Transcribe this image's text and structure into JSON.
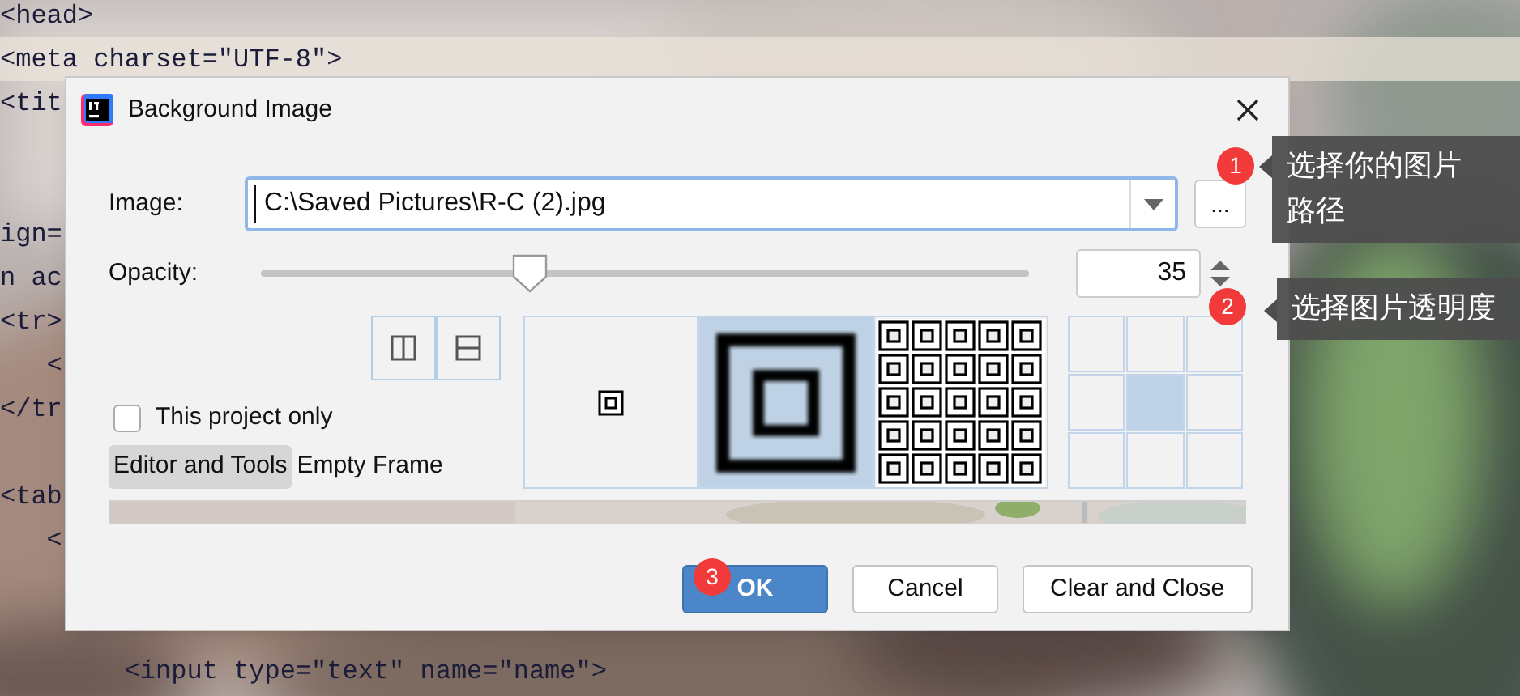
{
  "editor": {
    "lines": [
      {
        "kind": "code",
        "text": "<head>",
        "current": false
      },
      {
        "kind": "code",
        "text": "<meta charset=\"UTF-8\">",
        "current": true
      },
      {
        "kind": "code",
        "text": "<tit",
        "current": false
      },
      {
        "kind": "hidden"
      },
      {
        "kind": "hidden"
      },
      {
        "kind": "code",
        "text": "ign=",
        "current": false
      },
      {
        "kind": "code",
        "text": "n ac",
        "current": false
      },
      {
        "kind": "code",
        "text": "<tr>",
        "current": false
      },
      {
        "kind": "code",
        "text": "   <",
        "current": false
      },
      {
        "kind": "code",
        "text": "</tr",
        "current": false
      },
      {
        "kind": "hidden"
      },
      {
        "kind": "code",
        "text": "<tab",
        "current": false
      },
      {
        "kind": "code",
        "text": "   <",
        "current": false
      },
      {
        "kind": "hidden"
      },
      {
        "kind": "hidden"
      },
      {
        "kind": "code",
        "text": "        <input type=\"text\" name=\"name\">",
        "current": false
      }
    ]
  },
  "dialog": {
    "title": "Background Image",
    "image": {
      "label": "Image:",
      "value": "C:\\Saved Pictures\\R-C (2).jpg"
    },
    "browse_button": "...",
    "opacity": {
      "label": "Opacity:",
      "level": 0.35,
      "value": "35"
    },
    "this_project_only": {
      "label": "This project only",
      "checked": false
    },
    "tabs": [
      {
        "label": "Editor and Tools",
        "selected": true
      },
      {
        "label": "Empty Frame",
        "selected": false
      }
    ],
    "fill_modes": [
      {
        "kind": "center",
        "selected": false
      },
      {
        "kind": "scale",
        "selected": true
      },
      {
        "kind": "tile",
        "selected": false
      }
    ],
    "anchors": [
      {
        "selected": false
      },
      {
        "selected": false
      },
      {
        "selected": false
      },
      {
        "selected": false
      },
      {
        "selected": true
      },
      {
        "selected": false
      },
      {
        "selected": false
      },
      {
        "selected": false
      },
      {
        "selected": false
      }
    ],
    "buttons": [
      {
        "label": "OK",
        "default": true
      },
      {
        "label": "Cancel",
        "default": false
      },
      {
        "label": "Clear and Close",
        "default": false
      }
    ]
  },
  "callouts": [
    {
      "number": "1",
      "text": "选择你的图片路径"
    },
    {
      "number": "2",
      "text": "选择图片透明度"
    },
    {
      "number": "3"
    }
  ]
}
